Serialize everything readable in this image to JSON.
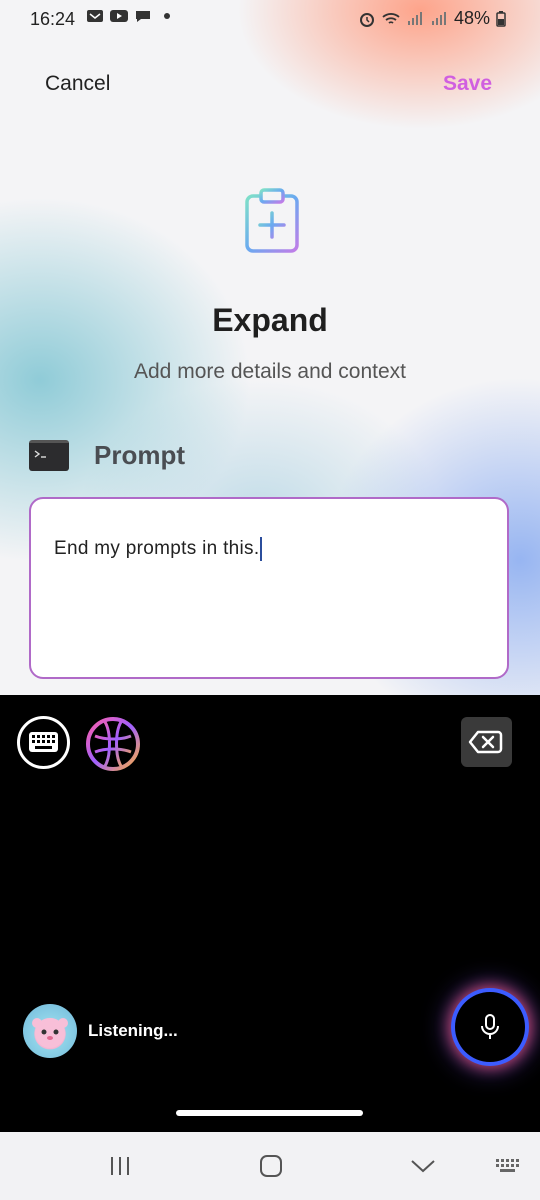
{
  "status_bar": {
    "time": "16:24",
    "battery": "48%",
    "left_icons": [
      "voicemail-icon",
      "youtube-icon",
      "chat-icon",
      "dot-icon"
    ],
    "right_icons": [
      "alarm-icon",
      "wifi-icon",
      "signal-icon",
      "signal-icon",
      "battery-icon"
    ]
  },
  "header": {
    "cancel_label": "Cancel",
    "save_label": "Save"
  },
  "main": {
    "icon": "clipboard-plus-icon",
    "title": "Expand",
    "subtitle": "Add more details and context",
    "prompt_label": "Prompt",
    "prompt_value": "End my prompts in this."
  },
  "keyboard": {
    "listening_text": "Listening...",
    "icons": [
      "keyboard-icon",
      "ai-orb-icon",
      "backspace-icon",
      "mic-icon"
    ]
  },
  "nav_bar": {
    "icons": [
      "recent-apps-icon",
      "home-icon",
      "back-icon",
      "keyboard-switch-icon"
    ]
  },
  "colors": {
    "accent": "#d05fe0",
    "textbox_border": "#b06ac8",
    "keyboard_bg": "#000000"
  }
}
